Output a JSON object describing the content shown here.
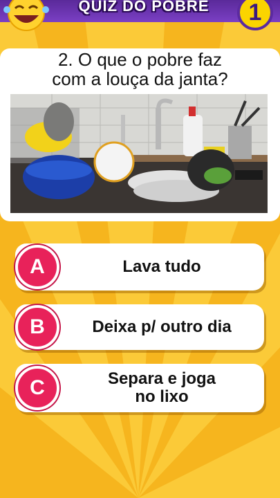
{
  "header": {
    "title": "QUIZ DO POBRE",
    "question_number": "1",
    "mascot_icon": "laughing-emoji-icon",
    "accent_color": "#6a34b0",
    "badge_color": "#fbd400"
  },
  "question": {
    "line1": "2. O que o pobre faz",
    "line2": "com a louça da janta?",
    "image": "dirty-dishes-sink-photo"
  },
  "options": [
    {
      "letter": "A",
      "text": "Lava tudo"
    },
    {
      "letter": "B",
      "text": "Deixa p/ outro dia"
    },
    {
      "letter": "C",
      "line1": "Separa e joga",
      "line2": "no lixo"
    }
  ],
  "colors": {
    "background": "#f6b51e",
    "option_letter": "#e8225a"
  }
}
